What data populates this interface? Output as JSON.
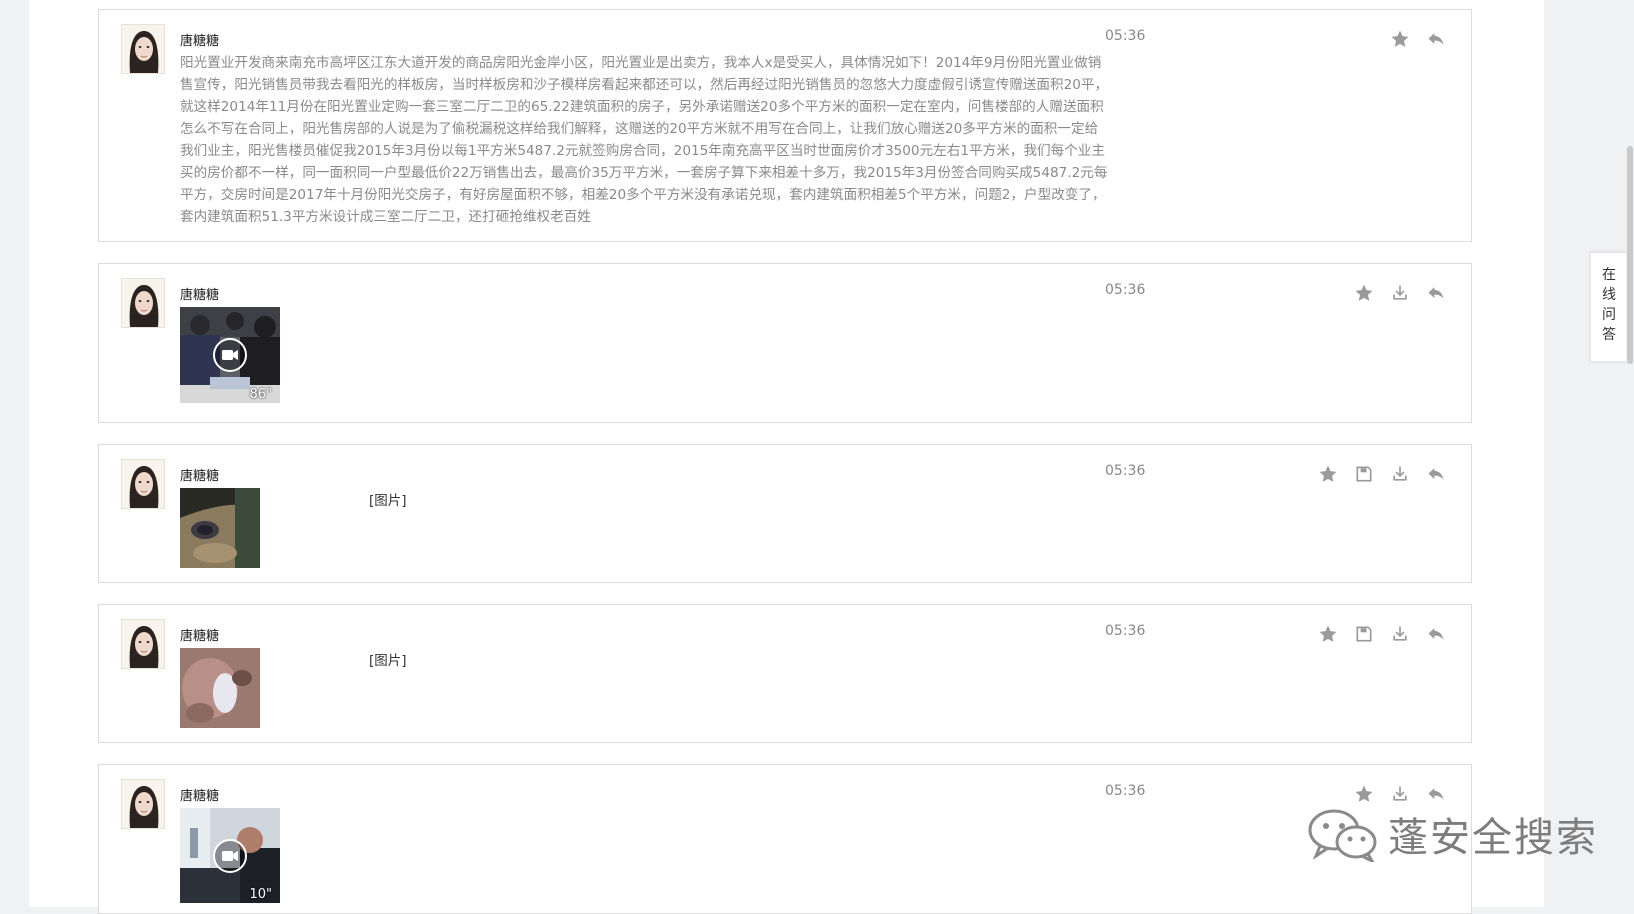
{
  "colors": {
    "icon": "#9a9a9a",
    "border": "#dcdcdc",
    "page_bg": "#f0f1f3",
    "meta_text": "#8a8a8a"
  },
  "side_tab": {
    "chars": [
      "在",
      "线",
      "问",
      "答"
    ]
  },
  "watermark": {
    "text": "蓬安全搜索",
    "icon": "wechat-logo-icon"
  },
  "messages": [
    {
      "sender": "唐糖糖",
      "time": "05:36",
      "type": "text",
      "text": "阳光置业开发商来南充市高坪区江东大道开发的商品房阳光金岸小区，阳光置业是出卖方，我本人x是受买人，具体情况如下！2014年9月份阳光置业做销售宣传，阳光销售员带我去看阳光的样板房，当时样板房和沙子模样房看起来都还可以，然后再经过阳光销售员的忽悠大力度虚假引诱宣传赠送面积20平，就这样2014年11月份在阳光置业定购一套三室二厅二卫的65.22建筑面积的房子，另外承诺赠送20多个平方米的面积一定在室内，问售楼部的人赠送面积怎么不写在合同上，阳光售房部的人说是为了偷税漏税这样给我们解释，这赠送的20平方米就不用写在合同上，让我们放心赠送20多平方米的面积一定给我们业主，阳光售楼员催促我2015年3月份以每1平方米5487.2元就签购房合同，2015年南充高平区当时世面房价才3500元左右1平方米，我们每个业主买的房价都不一样，同一面积同一户型最低价22万销售出去，最高价35万平方米，一套房子算下来相差十多万，我2015年3月份签合同购买成5487.2元每平方，交房时间是2017年十月份阳光交房子，有好房屋面积不够，相差20多个平方米没有承诺兑现，套内建筑面积相差5个平方米，问题2，户型改变了，套内建筑面积51.3平方米设计成三室二厅二卫，还打砸抢维权老百姓",
      "actions": [
        "star-icon",
        "reply-icon"
      ]
    },
    {
      "sender": "唐糖糖",
      "time": "05:36",
      "type": "video",
      "duration": "86\"",
      "actions": [
        "star-icon",
        "download-icon",
        "reply-icon"
      ]
    },
    {
      "sender": "唐糖糖",
      "time": "05:36",
      "type": "image",
      "tag": "[图片]",
      "actions": [
        "star-icon",
        "save-icon",
        "download-icon",
        "reply-icon"
      ]
    },
    {
      "sender": "唐糖糖",
      "time": "05:36",
      "type": "image",
      "tag": "[图片]",
      "actions": [
        "star-icon",
        "save-icon",
        "download-icon",
        "reply-icon"
      ]
    },
    {
      "sender": "唐糖糖",
      "time": "05:36",
      "type": "video",
      "duration": "10\"",
      "actions": [
        "star-icon",
        "download-icon",
        "reply-icon"
      ]
    }
  ]
}
